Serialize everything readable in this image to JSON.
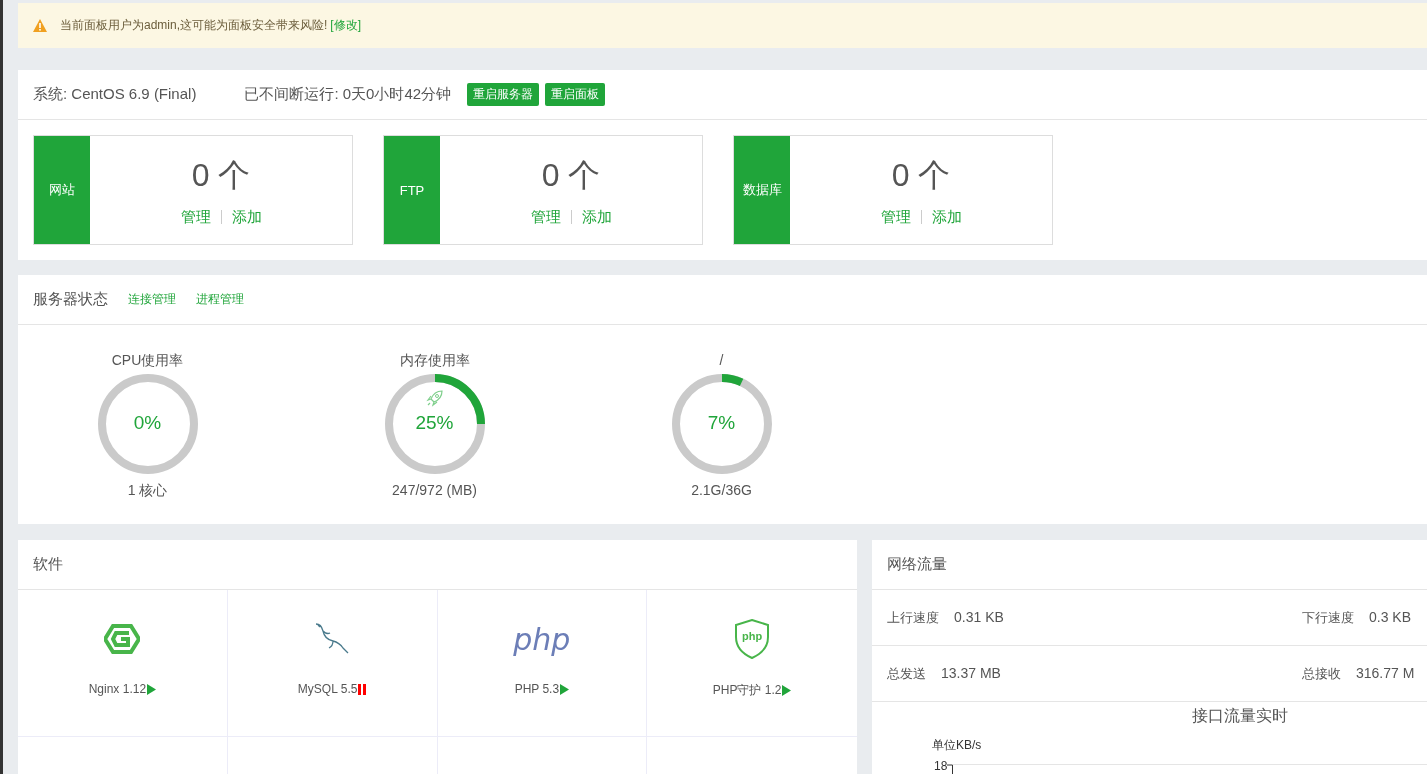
{
  "warning": {
    "text": "当前面板用户为admin,这可能为面板安全带来风险!",
    "link": "[修改]"
  },
  "system": {
    "os": "系统: CentOS 6.9 (Final)",
    "uptime": "已不间断运行: 0天0小时42分钟",
    "buttons": [
      "重启服务器",
      "重启面板"
    ],
    "cards": [
      {
        "label": "网站",
        "count": "0 个",
        "links": [
          "管理",
          "添加"
        ]
      },
      {
        "label": "FTP",
        "count": "0 个",
        "links": [
          "管理",
          "添加"
        ]
      },
      {
        "label": "数据库",
        "count": "0 个",
        "links": [
          "管理",
          "添加"
        ]
      }
    ]
  },
  "status": {
    "title": "服务器状态",
    "links": [
      "连接管理",
      "进程管理"
    ],
    "gauges": [
      {
        "title": "CPU使用率",
        "value": "0%",
        "level": 0,
        "detail": "1 核心",
        "boost_icon": false
      },
      {
        "title": "内存使用率",
        "value": "25%",
        "level": 0.25,
        "detail": "247/972 (MB)",
        "boost_icon": true
      },
      {
        "title": "/",
        "value": "7%",
        "level": 0.07,
        "detail": "2.1G/36G",
        "boost_icon": false
      }
    ]
  },
  "software": {
    "title": "软件",
    "items": [
      {
        "kind": "nginx",
        "name": "Nginx 1.12",
        "running": true
      },
      {
        "kind": "mysql",
        "name": "MySQL 5.5",
        "running": false
      },
      {
        "kind": "php",
        "logo_text": "php",
        "name": "PHP 5.3",
        "running": true
      },
      {
        "kind": "guard",
        "logo_text": "php",
        "name": "PHP守护 1.2",
        "running": true
      }
    ]
  },
  "traffic": {
    "title": "网络流量",
    "rows": [
      [
        {
          "label": "上行速度",
          "value": "0.31 KB"
        },
        {
          "label": "下行速度",
          "value": "0.3 KB"
        }
      ],
      [
        {
          "label": "总发送",
          "value": "13.37 MB"
        },
        {
          "label": "总接收",
          "value": "316.77 M"
        }
      ]
    ],
    "chart": {
      "title": "接口流量实时",
      "unit": "单位KB/s",
      "tick": "18"
    }
  }
}
